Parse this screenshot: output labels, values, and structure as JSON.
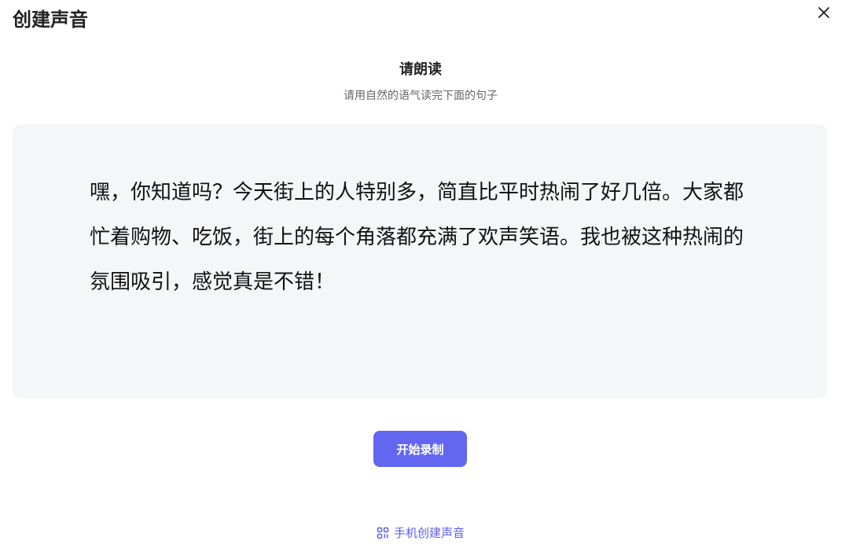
{
  "dialog": {
    "title": "创建声音",
    "close_icon": "close-icon"
  },
  "prompt": {
    "heading": "请朗读",
    "subheading": "请用自然的语气读完下面的句子"
  },
  "reading": {
    "text": "嘿，你知道吗？今天街上的人特别多，简直比平时热闹了好几倍。大家都忙着购物、吃饭，街上的每个角落都充满了欢声笑语。我也被这种热闹的氛围吸引，感觉真是不错！"
  },
  "actions": {
    "record_label": "开始录制",
    "phone_link_label": "手机创建声音",
    "phone_link_icon": "qr-code-icon"
  },
  "colors": {
    "accent": "#6366f1",
    "link": "#5b5ff0",
    "card_bg": "#f5f6f8"
  }
}
